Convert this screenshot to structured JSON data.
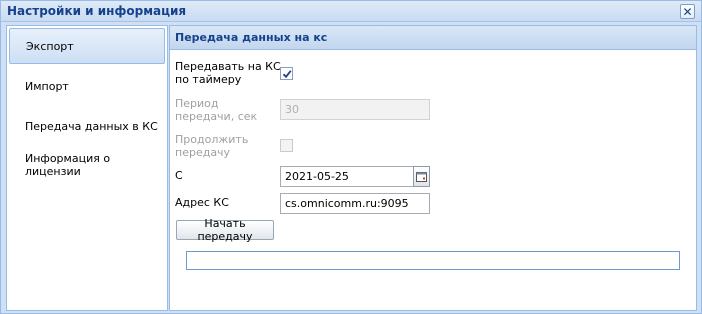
{
  "window": {
    "title": "Настройки и информация",
    "close_glyph": "✕"
  },
  "sidebar": {
    "items": [
      {
        "label": "Экспорт",
        "active": true
      },
      {
        "label": "Импорт",
        "active": false
      },
      {
        "label": "Передача данных в КС",
        "active": false
      },
      {
        "label": "Информация о лицензии",
        "active": false
      }
    ]
  },
  "panel": {
    "title": "Передача данных на кс",
    "timer_label_line1": "Передавать на КС",
    "timer_label_line2": "по таймеру",
    "timer_checked": true,
    "period_label_line1": "Период",
    "period_label_line2": "передачи, сек",
    "period_value": "30",
    "continue_label_line1": "Продолжить",
    "continue_label_line2": "передачу",
    "continue_checked": false,
    "from_label": "С",
    "from_value": "2021-05-25",
    "address_label": "Адрес КС",
    "address_value": "cs.omnicomm.ru:9095",
    "start_button": "Начать передачу",
    "progress_value": 0
  },
  "icons": {
    "close": "close-icon",
    "calendar": "calendar-icon",
    "checkmark": "checkmark-icon"
  },
  "colors": {
    "title_text": "#15428b",
    "border": "#99bbe8",
    "window_bg": "#cfe0f4",
    "progress_border": "#6c9bd1"
  }
}
